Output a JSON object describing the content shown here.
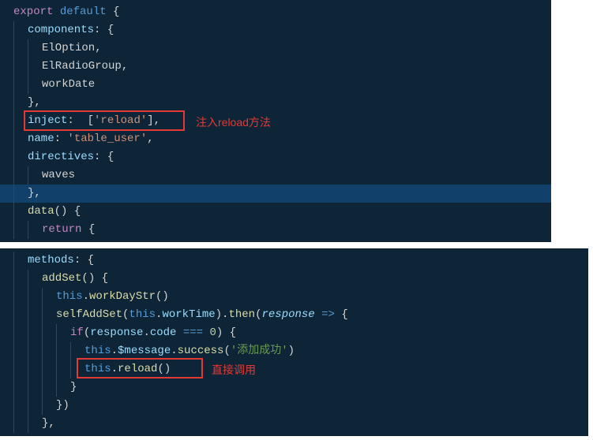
{
  "block1": {
    "l1": {
      "export": "export",
      "default": "default",
      "brace": " {"
    },
    "l2": {
      "prop": "components",
      "rest": ": {"
    },
    "l3": "ElOption,",
    "l4": "ElRadioGroup,",
    "l5": "workDate",
    "l6": "},",
    "l7": {
      "prop": "inject",
      "rest1": ":  [",
      "str": "'reload'",
      "rest2": "],"
    },
    "l8": {
      "prop": "name",
      "rest1": ": ",
      "str": "'table_user'",
      "rest2": ","
    },
    "l9": {
      "prop": "directives",
      "rest": ": {"
    },
    "l10": "waves",
    "l11": "},",
    "l12": {
      "meth": "data",
      "rest": "() {"
    },
    "l13": {
      "ret": "return",
      "rest": " {"
    }
  },
  "annotation1": "注入reload方法",
  "block2": {
    "l1": {
      "prop": "methods",
      "rest": ": {"
    },
    "l2": {
      "meth": "addSet",
      "rest": "() {"
    },
    "l3": {
      "this": "this",
      "dot": ".",
      "meth": "workDayStr",
      "rest": "()"
    },
    "l4": {
      "fn": "selfAddSet",
      "p1": "(",
      "this": "this",
      "dot": ".",
      "prop": "workTime",
      "p2": ").",
      "then": "then",
      "p3": "(",
      "param": "response",
      "arrow": " => ",
      "brace": "{"
    },
    "l5": {
      "if": "if",
      "p1": "(",
      "prop1": "response",
      "dot1": ".",
      "prop2": "code",
      "eq": " === ",
      "num": "0",
      "rest": ") {"
    },
    "l6": {
      "this": "this",
      "dot1": ".",
      "prop": "$message",
      "dot2": ".",
      "meth": "success",
      "p1": "(",
      "str": "'添加成功'",
      "p2": ")"
    },
    "l7": {
      "this": "this",
      "dot": ".",
      "meth": "reload",
      "rest": "()"
    },
    "l8": "}",
    "l9": "})",
    "l10": "},"
  },
  "annotation2": "直接调用"
}
